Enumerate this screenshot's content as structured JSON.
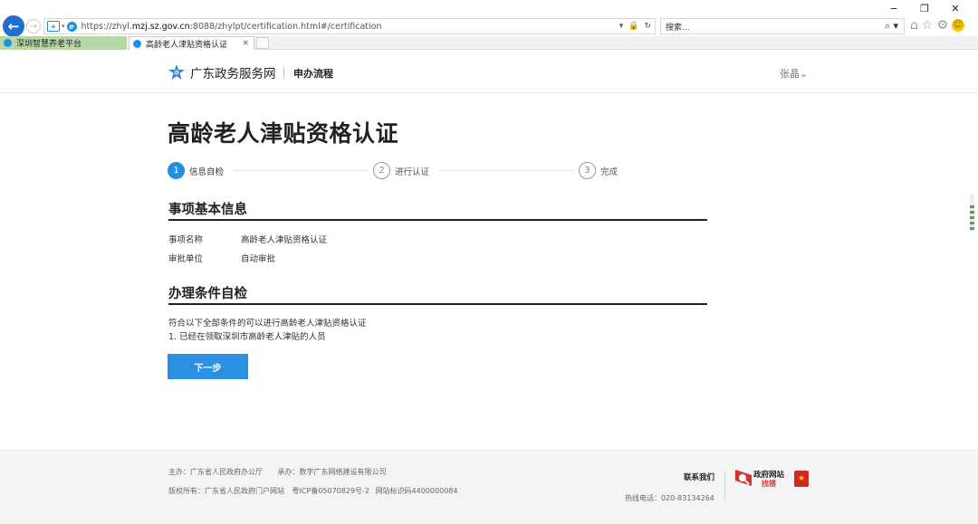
{
  "window_controls": {
    "minimize": "−",
    "restore": "❐",
    "close": "✕"
  },
  "browser": {
    "back_glyph": "←",
    "forward_glyph": "→",
    "url_prefix": "https://zhyl.",
    "url_host": "mzj.sz.gov.cn",
    "url_rest": ":8088/zhylpt/certification.html#/certification",
    "addr_icons": [
      "dropdown-icon",
      "lock-icon",
      "refresh-icon"
    ],
    "search_placeholder": "搜索...",
    "tool_icons": [
      "home-icon",
      "star-icon",
      "gear-icon",
      "smiley-icon"
    ]
  },
  "tabs": [
    {
      "label": "深圳智慧养老平台",
      "active": false
    },
    {
      "label": "高龄老人津贴资格认证",
      "active": true,
      "close": "×"
    }
  ],
  "header": {
    "logo_text": "广东政务服务网",
    "section": "申办流程",
    "user": "张晶"
  },
  "page": {
    "title": "高龄老人津贴资格认证",
    "steps": [
      {
        "number": "1",
        "label": "信息自检",
        "state": "active"
      },
      {
        "number": "2",
        "label": "进行认证",
        "state": "todo"
      },
      {
        "number": "3",
        "label": "完成",
        "state": "todo"
      }
    ],
    "basic_info": {
      "title": "事项基本信息",
      "rows": [
        {
          "key": "事项名称",
          "value": "高龄老人津贴资格认证"
        },
        {
          "key": "审批单位",
          "value": "自动审批"
        }
      ]
    },
    "conditions": {
      "title": "办理条件自检",
      "intro": "符合以下全部条件的可以进行高龄老人津贴资格认证",
      "items": [
        "1. 已经在领取深圳市高龄老人津贴的人员"
      ]
    },
    "next_button": "下一步"
  },
  "footer": {
    "host": "主办：广东省人民政府办公厅",
    "organizer": "承办：数字广东网络建设有限公司",
    "copyright": "版权所有：广东省人民政府门户网站",
    "icp": "粤ICP备05070829号-2",
    "site_id": "网站标识码4400000084",
    "contact": "联系我们",
    "hotline": "热线电话：020-83134264",
    "badge_title": "政府网站",
    "badge_sub": "找错"
  },
  "colors": {
    "accent": "#2c8fe1",
    "step_active": "#1e8fe2",
    "tab_inactive": "#b7d8a6",
    "badge_red": "#d8312b"
  }
}
